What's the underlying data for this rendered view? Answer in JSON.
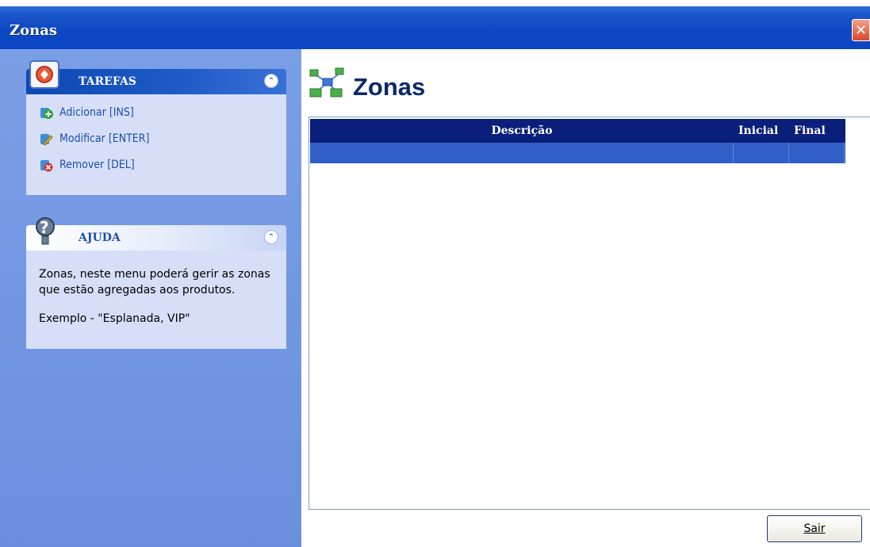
{
  "window": {
    "title": "Zonas",
    "close_label": "✕"
  },
  "tasks_panel": {
    "title": "TAREFAS",
    "collapse_glyph": "⌃",
    "items": [
      {
        "label": "Adicionar [INS]",
        "icon": "add-icon"
      },
      {
        "label": "Modificar [ENTER]",
        "icon": "edit-icon"
      },
      {
        "label": "Remover [DEL]",
        "icon": "remove-icon"
      }
    ]
  },
  "help_panel": {
    "title": "AJUDA",
    "collapse_glyph": "⌃",
    "text_1": "Zonas, neste menu poderá gerir as zonas que estão agregadas aos produtos.",
    "text_2": "Exemplo - \"Esplanada, VIP\""
  },
  "content": {
    "title": "Zonas",
    "table": {
      "columns": [
        "Descrição",
        "Inicial",
        "Final"
      ],
      "rows": [
        [
          "",
          "",
          ""
        ]
      ]
    }
  },
  "footer": {
    "exit_label": "Sair"
  },
  "colors": {
    "titlebar": "#0b46c4",
    "sidebar": "#7a9fe6",
    "header": "#0a1f7a",
    "selected_row": "#315fc7"
  }
}
